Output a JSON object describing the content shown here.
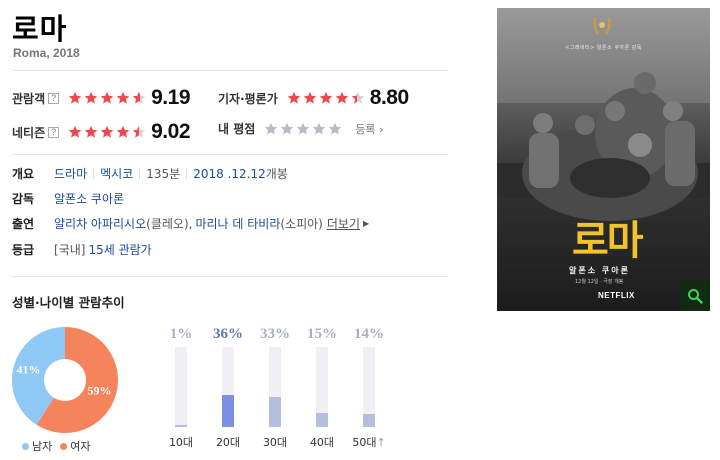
{
  "movie": {
    "title": "로마",
    "subtitle": "Roma, 2018"
  },
  "ratings": {
    "audience": {
      "label": "관람객",
      "help": "?",
      "score": "9.19",
      "stars": 4.6
    },
    "critics": {
      "label": "기자·평론가",
      "score": "8.80",
      "stars": 4.4
    },
    "netizen": {
      "label": "네티즌",
      "help": "?",
      "score": "9.02",
      "stars": 4.5
    },
    "mine": {
      "label": "내 평점",
      "stars": 0,
      "action": "등록"
    }
  },
  "info": {
    "overview": {
      "key": "개요",
      "genre": "드라마",
      "country": "멕시코",
      "runtime": "135분",
      "release_date": "2018 .12.12",
      "release_suffix": "개봉"
    },
    "director": {
      "key": "감독",
      "name": "알폰소 쿠아론"
    },
    "cast": {
      "key": "출연",
      "actor1": "얄리차 아파리시오",
      "role1": "(클레오),",
      "actor2": "마리나 데 타비라",
      "role2": "(소피아)",
      "more": "더보기"
    },
    "rating": {
      "key": "등급",
      "region": "[국내]",
      "grade": "15세 관람가"
    }
  },
  "demographics": {
    "title": "성별·나이별 관람추이",
    "gender": {
      "male": {
        "label": "남자",
        "percent": 41,
        "text": "41%",
        "color": "#8ec8f5"
      },
      "female": {
        "label": "여자",
        "percent": 59,
        "text": "59%",
        "color": "#f5845c"
      }
    },
    "ages": [
      {
        "label": "10대",
        "text": "1%",
        "value": 1,
        "top": false
      },
      {
        "label": "20대",
        "text": "36%",
        "value": 36,
        "top": true
      },
      {
        "label": "30대",
        "text": "33%",
        "value": 33,
        "top": false
      },
      {
        "label": "40대",
        "text": "15%",
        "value": 15,
        "top": false
      },
      {
        "label": "50대",
        "text": "14%",
        "value": 14,
        "top": false
      }
    ],
    "last_age_marker": "↑"
  },
  "poster": {
    "title": "로마",
    "director": "알폰소 쿠아론",
    "credits": "<그래비티> 알폰소 쿠아론 감독",
    "date": "12월 12일 · 극장 개봉",
    "brand": "NETFLIX",
    "title_color": "#f2c32a",
    "zoom_icon": "search-icon"
  }
}
